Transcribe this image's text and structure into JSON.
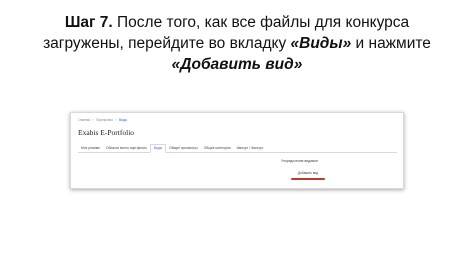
{
  "slide": {
    "title_line1_bold": "Шаг 7.",
    "title_line1_rest": " После того, как все файлы для конкурса",
    "title_line2_plain": "загружены, перейдите во вкладку ",
    "title_line2_emph": "«Виды»",
    "title_line2_tail": " и нажмите",
    "title_line3_emph": "«Добавить вид»"
  },
  "screenshot": {
    "breadcrumb": [
      "Главная",
      "Портфолио",
      "Виды"
    ],
    "app_title": "Exabis E-Portfolio",
    "tabs": [
      {
        "label": "Мое резюме",
        "active": false
      },
      {
        "label": "Области моего портфолио",
        "active": false
      },
      {
        "label": "Виды",
        "active": true
      },
      {
        "label": "Общие просмотры",
        "active": false
      },
      {
        "label": "Общие категории",
        "active": false
      },
      {
        "label": "Импорт / Экспорт",
        "active": false
      }
    ],
    "content_link": "Упорядочение видимое",
    "add_view_button": "Добавить вид",
    "highlight_color": "#c0392b"
  }
}
